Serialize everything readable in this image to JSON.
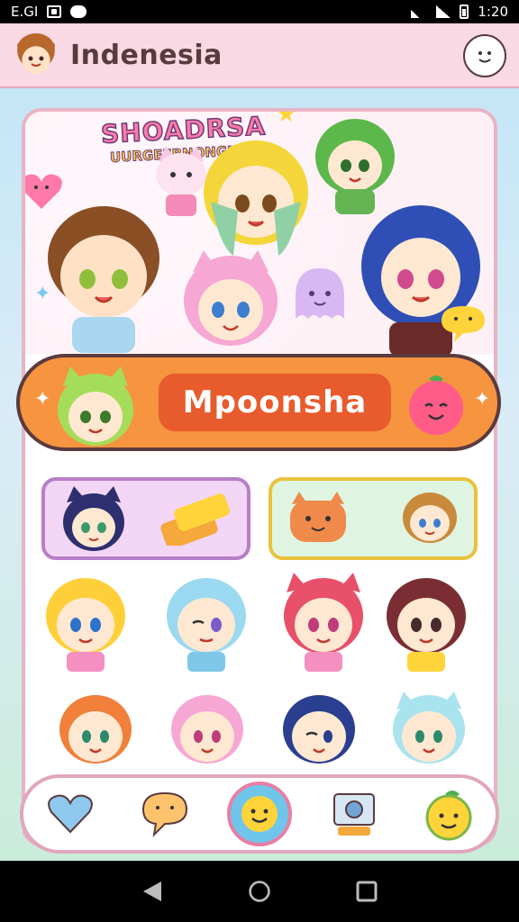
{
  "status_bar": {
    "carrier": "E.GI",
    "time": "1:20"
  },
  "app": {
    "title": "Indenesia"
  },
  "hero": {
    "title": "SHOADRSA",
    "subtitle": "UURGEFBNONGILI"
  },
  "banner": {
    "label": "Mpoonsha"
  },
  "colors": {
    "header_bg": "#f9d9e3",
    "banner_orange": "#f6943f",
    "banner_pill": "#e85b2d",
    "card_border_pink": "#e8b4c5",
    "category_purple": "#f3d6f5",
    "category_yellow_border": "#e9c23d"
  },
  "icons": {
    "profile": "smiley-face-icon",
    "nav": [
      "heart-icon",
      "chat-bubble-icon",
      "smiley-icon",
      "camera-icon",
      "fruit-icon"
    ],
    "system": [
      "back-icon",
      "home-icon",
      "recents-icon"
    ]
  }
}
